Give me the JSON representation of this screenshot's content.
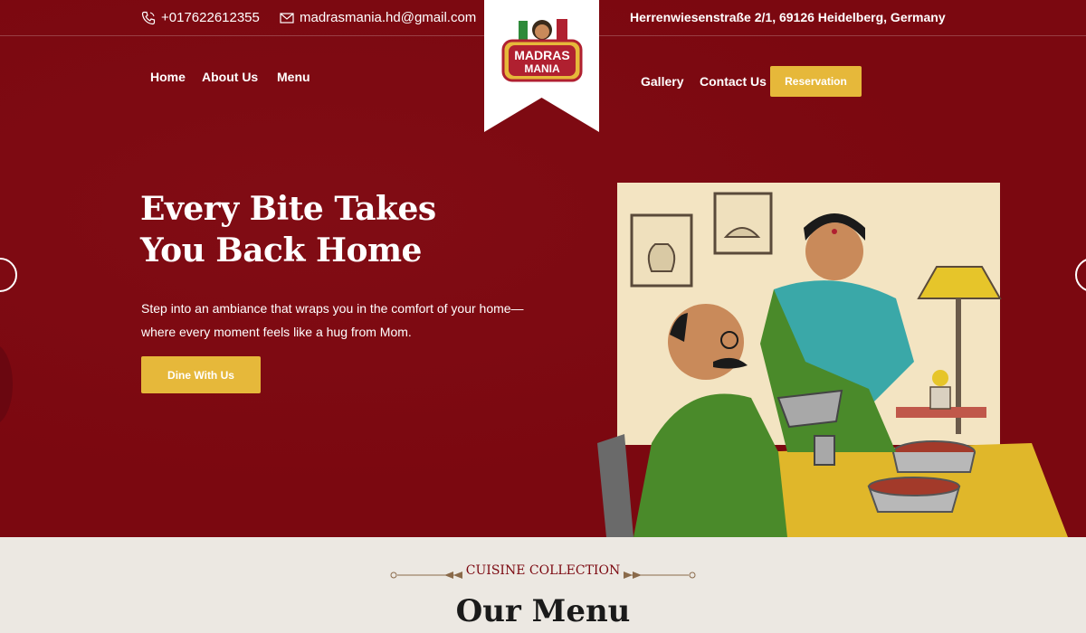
{
  "topbar": {
    "phone": "+017622612355",
    "email": "madrasmania.hd@gmail.com",
    "address": "Herrenwiesenstraße 2/1, 69126 Heidelberg, Germany"
  },
  "nav": {
    "home": "Home",
    "about": "About Us",
    "menu": "Menu",
    "gallery": "Gallery",
    "contact": "Contact Us",
    "reservation": "Reservation"
  },
  "logo": {
    "line1": "MADRAS",
    "line2": "MANIA"
  },
  "hero": {
    "title_line1": "Every Bite Takes",
    "title_line2": "You Back Home",
    "description": "Step into an ambiance that wraps you in the comfort of your home—where every moment feels like a hug from Mom.",
    "cta": "Dine With Us"
  },
  "menu_section": {
    "eyebrow": "CUISINE COLLECTION",
    "heading": "Our Menu"
  },
  "colors": {
    "brand_red": "#7b0810",
    "accent_yellow": "#e6b83a",
    "section_bg": "#ece8e2"
  },
  "icons": [
    "phone-icon",
    "mail-icon",
    "chevron-left-icon",
    "chevron-right-icon"
  ]
}
